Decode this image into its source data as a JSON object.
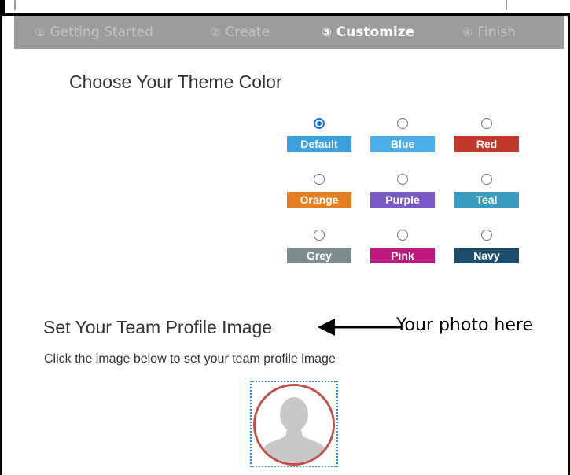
{
  "steps": [
    {
      "num": "①",
      "label": "Getting Started",
      "active": false
    },
    {
      "num": "②",
      "label": "Create",
      "active": false
    },
    {
      "num": "③",
      "label": "Customize",
      "active": true
    },
    {
      "num": "④",
      "label": "Finish",
      "active": false
    }
  ],
  "theme": {
    "title": "Choose Your Theme Color",
    "selected": "Default",
    "options": [
      {
        "label": "Default",
        "color": "#3aa0e0",
        "checked": true
      },
      {
        "label": "Blue",
        "color": "#4aaeea",
        "checked": false
      },
      {
        "label": "Red",
        "color": "#c0392b",
        "checked": false
      },
      {
        "label": "Orange",
        "color": "#e67e22",
        "checked": false
      },
      {
        "label": "Purple",
        "color": "#7b59c9",
        "checked": false
      },
      {
        "label": "Teal",
        "color": "#3a9cc0",
        "checked": false
      },
      {
        "label": "Grey",
        "color": "#7f8c8d",
        "checked": false
      },
      {
        "label": "Pink",
        "color": "#c0167e",
        "checked": false
      },
      {
        "label": "Navy",
        "color": "#1e4d6b",
        "checked": false
      }
    ]
  },
  "profile": {
    "title": "Set Your Team Profile Image",
    "instruction": "Click the image below to set your team profile image",
    "annotation": "Your photo here",
    "placeholder_icon": "person-silhouette-icon"
  }
}
